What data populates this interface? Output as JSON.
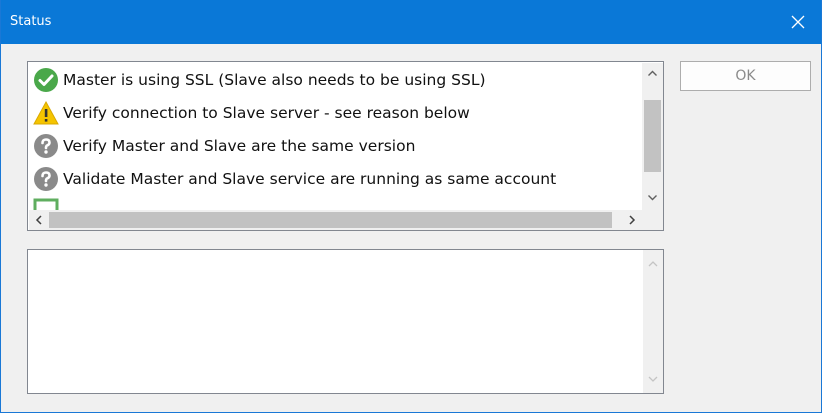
{
  "window": {
    "title": "Status",
    "colors": {
      "titlebar": "#0a78d7",
      "title_text": "#ffffff",
      "body": "#f0f0f0"
    }
  },
  "status_list": {
    "items": [
      {
        "icon": "check-circle-icon",
        "status": "success",
        "text": "Master is using SSL (Slave also needs to be using SSL)"
      },
      {
        "icon": "warning-icon",
        "status": "warning",
        "text": "Verify connection to Slave server - see reason below"
      },
      {
        "icon": "question-icon",
        "status": "pending",
        "text": "Verify Master and Slave are the same version"
      },
      {
        "icon": "question-icon",
        "status": "pending",
        "text": "Validate Master and Slave service are running as same account"
      },
      {
        "icon": "partial-item-icon",
        "status": "unknown",
        "text": ""
      }
    ]
  },
  "details": {
    "text": ""
  },
  "buttons": {
    "ok_label": "OK"
  }
}
